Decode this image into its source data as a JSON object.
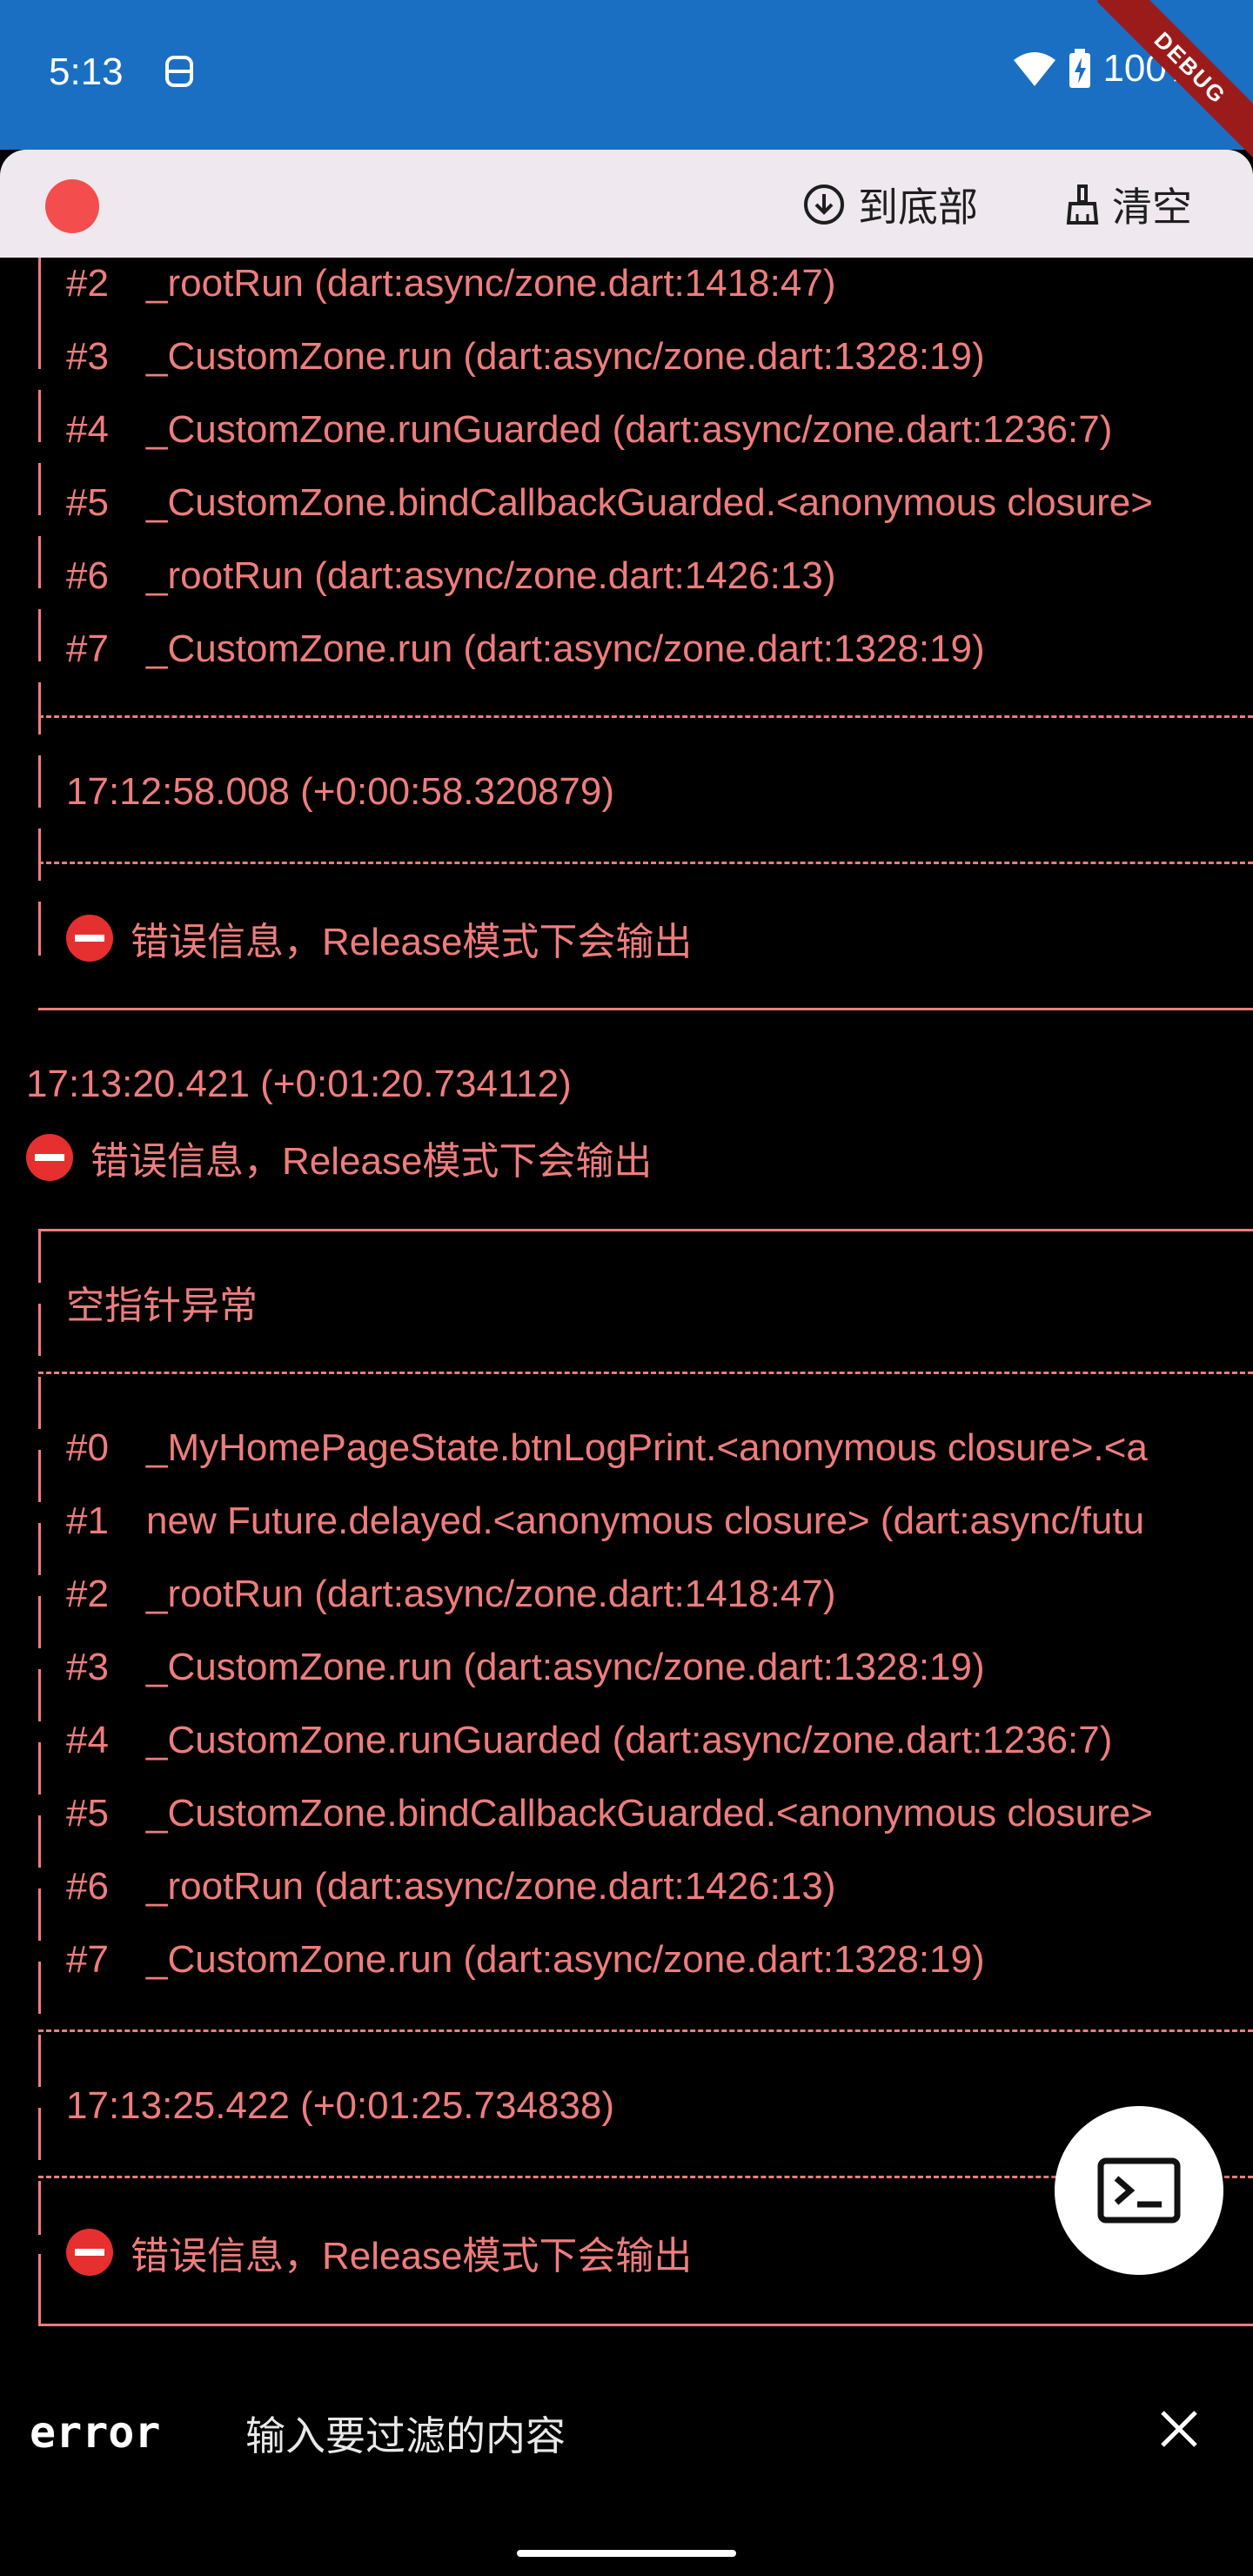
{
  "status_bar": {
    "time": "5:13",
    "battery": "100%"
  },
  "debug_banner": "DEBUG",
  "toolbar": {
    "scroll_bottom_label": "到底部",
    "clear_label": "清空"
  },
  "log_block_1": {
    "frames": [
      {
        "num": "#2",
        "text": "_rootRun (dart:async/zone.dart:1418:47)"
      },
      {
        "num": "#3",
        "text": "_CustomZone.run (dart:async/zone.dart:1328:19)"
      },
      {
        "num": "#4",
        "text": "_CustomZone.runGuarded (dart:async/zone.dart:1236:7)"
      },
      {
        "num": "#5",
        "text": "_CustomZone.bindCallbackGuarded.<anonymous closure>"
      },
      {
        "num": "#6",
        "text": "_rootRun (dart:async/zone.dart:1426:13)"
      },
      {
        "num": "#7",
        "text": "_CustomZone.run (dart:async/zone.dart:1328:19)"
      }
    ],
    "timestamp": "17:12:58.008 (+0:00:58.320879)",
    "message": "错误信息，Release模式下会输出"
  },
  "plain_entry": {
    "timestamp": "17:13:20.421 (+0:01:20.734112)",
    "message": "错误信息，Release模式下会输出"
  },
  "log_block_2": {
    "title": "空指针异常",
    "frames": [
      {
        "num": "#0",
        "text": "_MyHomePageState.btnLogPrint.<anonymous closure>.<a"
      },
      {
        "num": "#1",
        "text": "new Future.delayed.<anonymous closure> (dart:async/futu"
      },
      {
        "num": "#2",
        "text": "_rootRun (dart:async/zone.dart:1418:47)"
      },
      {
        "num": "#3",
        "text": "_CustomZone.run (dart:async/zone.dart:1328:19)"
      },
      {
        "num": "#4",
        "text": "_CustomZone.runGuarded (dart:async/zone.dart:1236:7)"
      },
      {
        "num": "#5",
        "text": "_CustomZone.bindCallbackGuarded.<anonymous closure>"
      },
      {
        "num": "#6",
        "text": "_rootRun (dart:async/zone.dart:1426:13)"
      },
      {
        "num": "#7",
        "text": "_CustomZone.run (dart:async/zone.dart:1328:19)"
      }
    ],
    "timestamp": "17:13:25.422 (+0:01:25.734838)",
    "message": "错误信息，Release模式下会输出"
  },
  "filter_bar": {
    "level": "error",
    "placeholder": "输入要过滤的内容"
  }
}
